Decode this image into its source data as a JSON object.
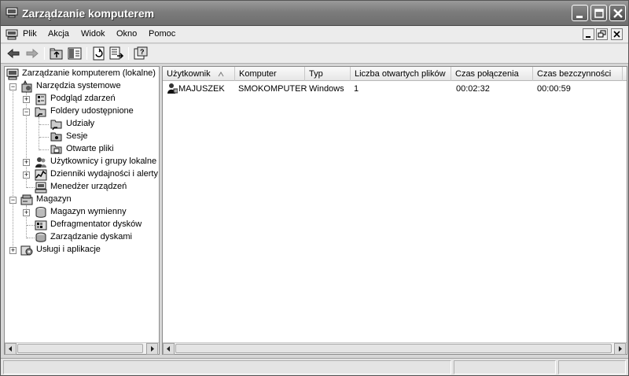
{
  "window": {
    "title": "Zarządzanie komputerem"
  },
  "menu": {
    "items": [
      {
        "label": "Plik"
      },
      {
        "label": "Akcja"
      },
      {
        "label": "Widok"
      },
      {
        "label": "Okno"
      },
      {
        "label": "Pomoc"
      }
    ]
  },
  "toolbar": {
    "icons": [
      "back-arrow-icon",
      "forward-arrow-icon",
      "up-folder-icon",
      "show-hide-tree-icon",
      "refresh-icon",
      "export-list-icon",
      "help-icon"
    ]
  },
  "tree": {
    "root": "Zarządzanie komputerem (lokalne)",
    "items": [
      {
        "label": "Narzędzia systemowe"
      },
      {
        "label": "Podgląd zdarzeń"
      },
      {
        "label": "Foldery udostępnione"
      },
      {
        "label": "Udziały"
      },
      {
        "label": "Sesje"
      },
      {
        "label": "Otwarte pliki"
      },
      {
        "label": "Użytkownicy i grupy lokalne"
      },
      {
        "label": "Dzienniki wydajności i alerty"
      },
      {
        "label": "Menedżer urządzeń"
      },
      {
        "label": "Magazyn"
      },
      {
        "label": "Magazyn wymienny"
      },
      {
        "label": "Defragmentator dysków"
      },
      {
        "label": "Zarządzanie dyskami"
      },
      {
        "label": "Usługi i aplikacje"
      }
    ]
  },
  "list": {
    "columns": [
      "Użytkownik",
      "Komputer",
      "Typ",
      "Liczba otwartych plików",
      "Czas połączenia",
      "Czas bezczynności"
    ],
    "rows": [
      {
        "user": "MAJUSZEK",
        "computer": "SMOKOMPUTER",
        "type": "Windows",
        "open_files": "1",
        "connected": "00:02:32",
        "idle": "00:00:59"
      }
    ]
  },
  "colors": {
    "titlebar": "#7c7c7c",
    "window_bg": "#d6d6d6"
  }
}
